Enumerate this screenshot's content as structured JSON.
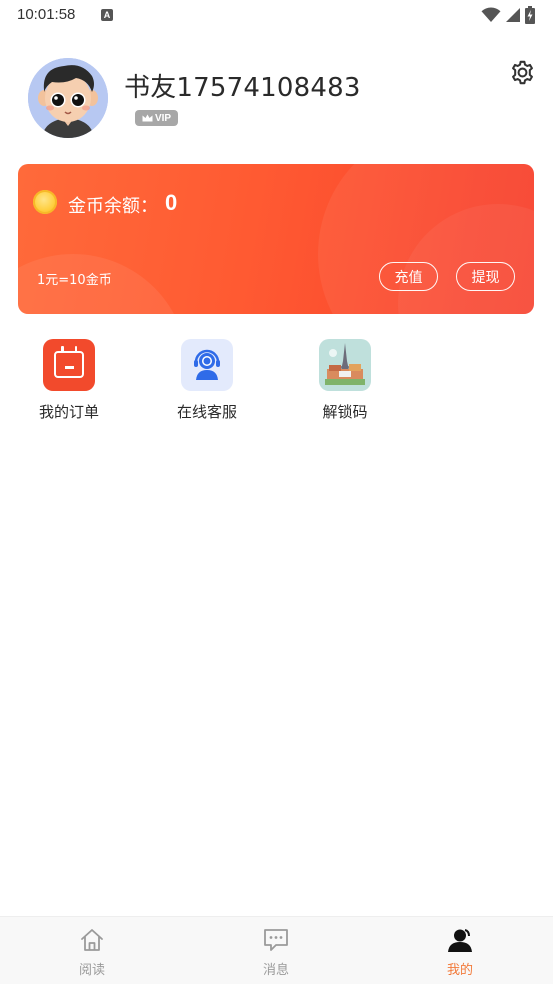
{
  "status_bar": {
    "time": "10:01:58",
    "notification_icon": "a-icon",
    "right_icons": [
      "wifi-icon",
      "signal-icon",
      "battery-charging-icon"
    ]
  },
  "profile": {
    "username": "书友17574108483",
    "vip_label": "VIP",
    "settings_icon": "gear-icon"
  },
  "coin_card": {
    "balance_label": "金币余额：",
    "balance_value": "0",
    "rate_text": "1元=10金币",
    "recharge_label": "充值",
    "withdraw_label": "提现",
    "colors": {
      "start": "#ff6a3a",
      "end": "#f73f2c"
    }
  },
  "shortcuts": [
    {
      "label": "我的订单",
      "icon": "calendar-icon"
    },
    {
      "label": "在线客服",
      "icon": "customer-service-icon"
    },
    {
      "label": "解锁码",
      "icon": "landmark-icon"
    }
  ],
  "bottom_nav": {
    "items": [
      {
        "label": "阅读",
        "icon": "home-icon",
        "active": false
      },
      {
        "label": "消息",
        "icon": "message-icon",
        "active": false
      },
      {
        "label": "我的",
        "icon": "user-icon",
        "active": true
      }
    ],
    "active_color": "#f27a3a",
    "inactive_color": "#9a9a9a"
  }
}
